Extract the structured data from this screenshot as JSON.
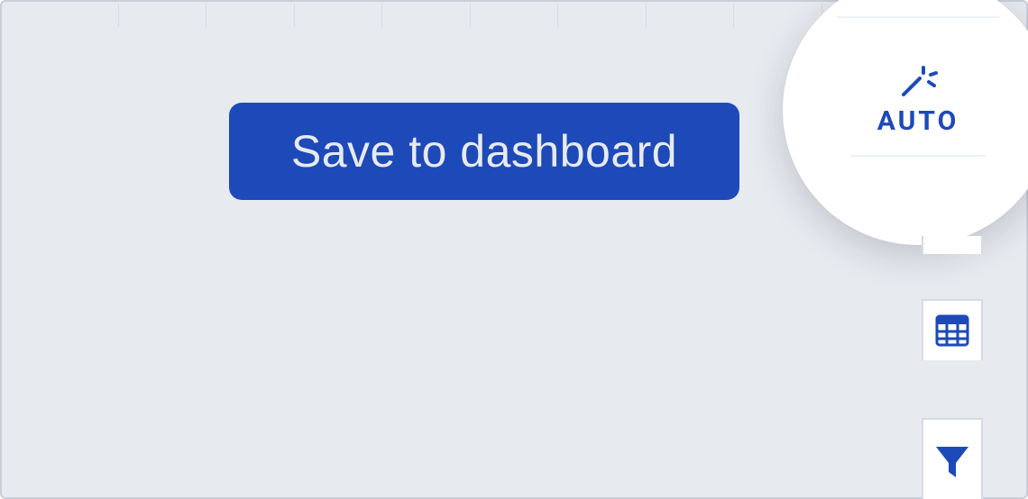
{
  "toolbar": {
    "save_label": "Save to dashboard"
  },
  "viz_controls": {
    "auto_label": "AUTO"
  },
  "colors": {
    "primary": "#1d4ab8",
    "panel": "#e7eaef",
    "card": "#ffffff",
    "line": "#d6dbe2"
  }
}
